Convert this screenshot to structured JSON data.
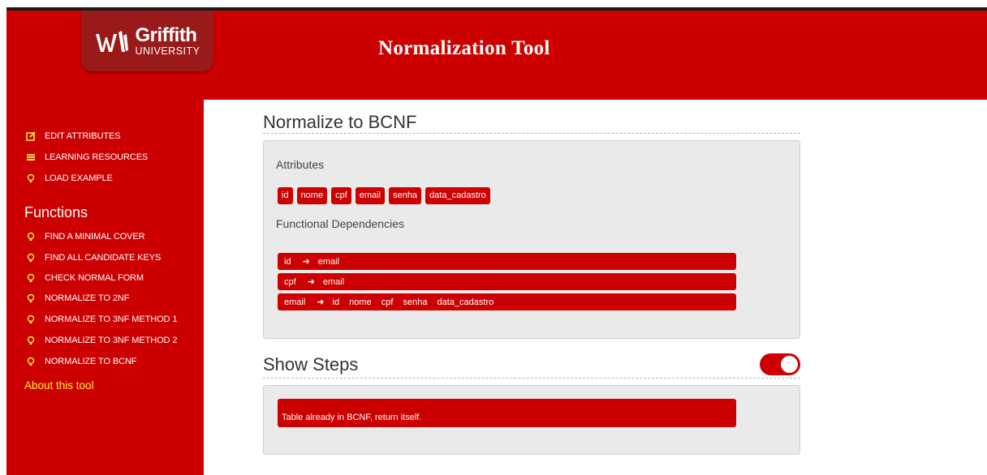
{
  "header": {
    "logo_name": "Griffith",
    "logo_sub": "UNIVERSITY",
    "title": "Normalization Tool"
  },
  "sidebar": {
    "top_items": [
      {
        "label": "EDIT ATTRIBUTES",
        "icon": "edit-icon"
      },
      {
        "label": "LEARNING RESOURCES",
        "icon": "book-icon"
      },
      {
        "label": "LOAD EXAMPLE",
        "icon": "bulb-icon"
      }
    ],
    "functions_heading": "Functions",
    "functions": [
      {
        "label": "FIND A MINIMAL COVER",
        "icon": "bulb-icon"
      },
      {
        "label": "FIND ALL CANDIDATE KEYS",
        "icon": "bulb-icon"
      },
      {
        "label": "CHECK NORMAL FORM",
        "icon": "bulb-icon"
      },
      {
        "label": "NORMALIZE TO 2NF",
        "icon": "bulb-icon"
      },
      {
        "label": "NORMALIZE TO 3NF METHOD 1",
        "icon": "bulb-icon"
      },
      {
        "label": "NORMALIZE TO 3NF METHOD 2",
        "icon": "bulb-icon"
      },
      {
        "label": "NORMALIZE TO BCNF",
        "icon": "bulb-icon"
      }
    ],
    "about": "About this tool"
  },
  "main": {
    "title": "Normalize to BCNF",
    "attributes_label": "Attributes",
    "attributes": [
      "id",
      "nome",
      "cpf",
      "email",
      "senha",
      "data_cadastro"
    ],
    "fd_label": "Functional Dependencies",
    "arrow_icon": "arrow-right-icon",
    "dependencies": [
      {
        "lhs": "id",
        "rhs": [
          "email"
        ]
      },
      {
        "lhs": "cpf",
        "rhs": [
          "email"
        ]
      },
      {
        "lhs": "email",
        "rhs": [
          "id",
          "nome",
          "cpf",
          "senha",
          "data_cadastro"
        ]
      }
    ],
    "steps_title": "Show Steps",
    "steps_toggle_on": true,
    "steps_message": "Table already in BCNF, return itself."
  },
  "colors": {
    "brand_red": "#cc0000",
    "logo_tab": "#9a1a1a",
    "about_link": "#ffee33",
    "panel_bg": "#eaeaea"
  }
}
